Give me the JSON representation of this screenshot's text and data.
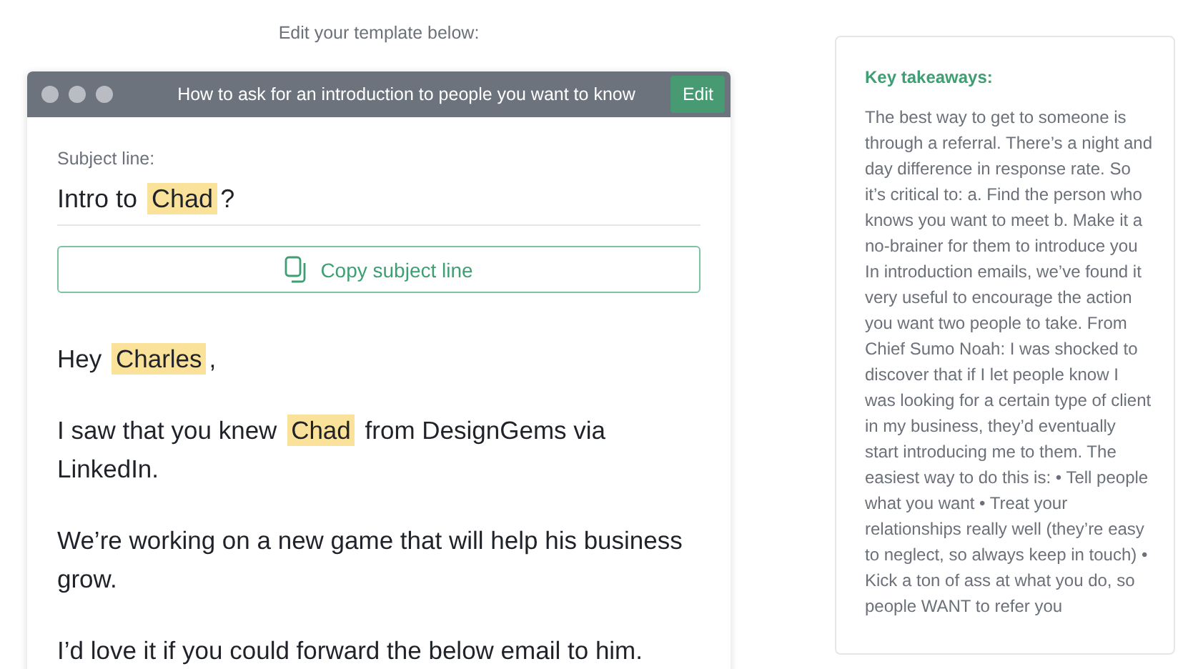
{
  "heading": "Edit your template below:",
  "template_window": {
    "title": "How to ask for an introduction to people you want to know",
    "edit_button": "Edit",
    "subject_label": "Subject line:",
    "subject": [
      {
        "kind": "text",
        "text": "Intro to "
      },
      {
        "kind": "variable",
        "text": "Chad"
      },
      {
        "kind": "text",
        "text": "?"
      }
    ],
    "copy_button": "Copy subject line",
    "body": [
      [
        {
          "kind": "text",
          "text": "Hey "
        },
        {
          "kind": "variable",
          "text": "Charles"
        },
        {
          "kind": "text",
          "text": ","
        }
      ],
      [
        {
          "kind": "text",
          "text": "I saw that you knew "
        },
        {
          "kind": "variable",
          "text": "Chad"
        },
        {
          "kind": "text",
          "text": " from DesignGems via LinkedIn."
        }
      ],
      [
        {
          "kind": "text",
          "text": "We’re working on a new game that will help his business grow."
        }
      ],
      [
        {
          "kind": "text",
          "text": "I’d love it if you could forward the below email to him."
        }
      ]
    ]
  },
  "key_takeaways": {
    "title": "Key takeaways:",
    "text": "The best way to get to someone is through a referral. There’s a night and day difference in response rate. So it’s critical to: a. Find the person who knows you want to meet b. Make it a no-brainer for them to introduce you In introduction emails, we’ve found it very useful to encourage the action you want two people to take. From Chief Sumo Noah: I was shocked to discover that if I let people know I was looking for a certain type of client in my business, they’d eventually start introducing me to them. The easiest way to do this is: • Tell people what you want • Treat your relationships really well (they’re easy to neglect, so always keep in touch) • Kick a ton of ass at what you do, so people WANT to refer you"
  }
}
